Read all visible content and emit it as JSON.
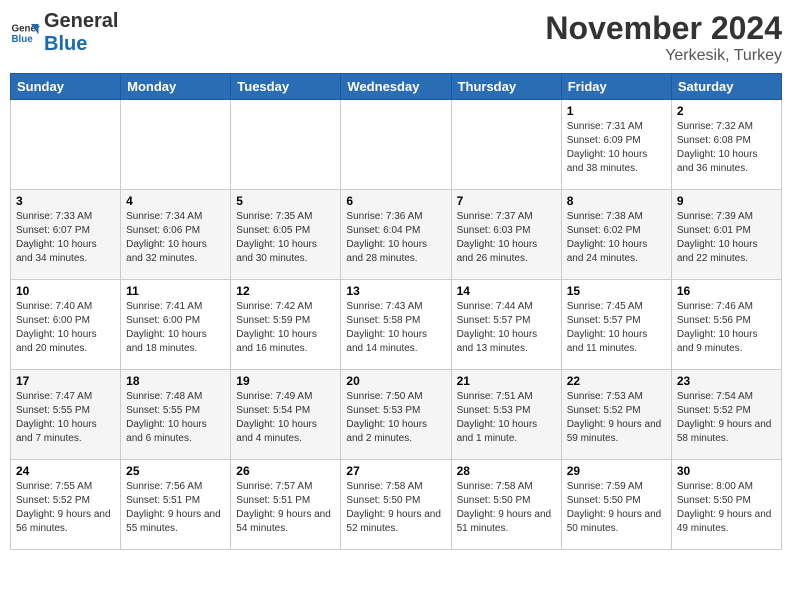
{
  "header": {
    "logo_line1": "General",
    "logo_line2": "Blue",
    "month_title": "November 2024",
    "location": "Yerkesik, Turkey"
  },
  "weekdays": [
    "Sunday",
    "Monday",
    "Tuesday",
    "Wednesday",
    "Thursday",
    "Friday",
    "Saturday"
  ],
  "weeks": [
    [
      {
        "day": "",
        "info": ""
      },
      {
        "day": "",
        "info": ""
      },
      {
        "day": "",
        "info": ""
      },
      {
        "day": "",
        "info": ""
      },
      {
        "day": "",
        "info": ""
      },
      {
        "day": "1",
        "info": "Sunrise: 7:31 AM\nSunset: 6:09 PM\nDaylight: 10 hours and 38 minutes."
      },
      {
        "day": "2",
        "info": "Sunrise: 7:32 AM\nSunset: 6:08 PM\nDaylight: 10 hours and 36 minutes."
      }
    ],
    [
      {
        "day": "3",
        "info": "Sunrise: 7:33 AM\nSunset: 6:07 PM\nDaylight: 10 hours and 34 minutes."
      },
      {
        "day": "4",
        "info": "Sunrise: 7:34 AM\nSunset: 6:06 PM\nDaylight: 10 hours and 32 minutes."
      },
      {
        "day": "5",
        "info": "Sunrise: 7:35 AM\nSunset: 6:05 PM\nDaylight: 10 hours and 30 minutes."
      },
      {
        "day": "6",
        "info": "Sunrise: 7:36 AM\nSunset: 6:04 PM\nDaylight: 10 hours and 28 minutes."
      },
      {
        "day": "7",
        "info": "Sunrise: 7:37 AM\nSunset: 6:03 PM\nDaylight: 10 hours and 26 minutes."
      },
      {
        "day": "8",
        "info": "Sunrise: 7:38 AM\nSunset: 6:02 PM\nDaylight: 10 hours and 24 minutes."
      },
      {
        "day": "9",
        "info": "Sunrise: 7:39 AM\nSunset: 6:01 PM\nDaylight: 10 hours and 22 minutes."
      }
    ],
    [
      {
        "day": "10",
        "info": "Sunrise: 7:40 AM\nSunset: 6:00 PM\nDaylight: 10 hours and 20 minutes."
      },
      {
        "day": "11",
        "info": "Sunrise: 7:41 AM\nSunset: 6:00 PM\nDaylight: 10 hours and 18 minutes."
      },
      {
        "day": "12",
        "info": "Sunrise: 7:42 AM\nSunset: 5:59 PM\nDaylight: 10 hours and 16 minutes."
      },
      {
        "day": "13",
        "info": "Sunrise: 7:43 AM\nSunset: 5:58 PM\nDaylight: 10 hours and 14 minutes."
      },
      {
        "day": "14",
        "info": "Sunrise: 7:44 AM\nSunset: 5:57 PM\nDaylight: 10 hours and 13 minutes."
      },
      {
        "day": "15",
        "info": "Sunrise: 7:45 AM\nSunset: 5:57 PM\nDaylight: 10 hours and 11 minutes."
      },
      {
        "day": "16",
        "info": "Sunrise: 7:46 AM\nSunset: 5:56 PM\nDaylight: 10 hours and 9 minutes."
      }
    ],
    [
      {
        "day": "17",
        "info": "Sunrise: 7:47 AM\nSunset: 5:55 PM\nDaylight: 10 hours and 7 minutes."
      },
      {
        "day": "18",
        "info": "Sunrise: 7:48 AM\nSunset: 5:55 PM\nDaylight: 10 hours and 6 minutes."
      },
      {
        "day": "19",
        "info": "Sunrise: 7:49 AM\nSunset: 5:54 PM\nDaylight: 10 hours and 4 minutes."
      },
      {
        "day": "20",
        "info": "Sunrise: 7:50 AM\nSunset: 5:53 PM\nDaylight: 10 hours and 2 minutes."
      },
      {
        "day": "21",
        "info": "Sunrise: 7:51 AM\nSunset: 5:53 PM\nDaylight: 10 hours and 1 minute."
      },
      {
        "day": "22",
        "info": "Sunrise: 7:53 AM\nSunset: 5:52 PM\nDaylight: 9 hours and 59 minutes."
      },
      {
        "day": "23",
        "info": "Sunrise: 7:54 AM\nSunset: 5:52 PM\nDaylight: 9 hours and 58 minutes."
      }
    ],
    [
      {
        "day": "24",
        "info": "Sunrise: 7:55 AM\nSunset: 5:52 PM\nDaylight: 9 hours and 56 minutes."
      },
      {
        "day": "25",
        "info": "Sunrise: 7:56 AM\nSunset: 5:51 PM\nDaylight: 9 hours and 55 minutes."
      },
      {
        "day": "26",
        "info": "Sunrise: 7:57 AM\nSunset: 5:51 PM\nDaylight: 9 hours and 54 minutes."
      },
      {
        "day": "27",
        "info": "Sunrise: 7:58 AM\nSunset: 5:50 PM\nDaylight: 9 hours and 52 minutes."
      },
      {
        "day": "28",
        "info": "Sunrise: 7:58 AM\nSunset: 5:50 PM\nDaylight: 9 hours and 51 minutes."
      },
      {
        "day": "29",
        "info": "Sunrise: 7:59 AM\nSunset: 5:50 PM\nDaylight: 9 hours and 50 minutes."
      },
      {
        "day": "30",
        "info": "Sunrise: 8:00 AM\nSunset: 5:50 PM\nDaylight: 9 hours and 49 minutes."
      }
    ]
  ]
}
